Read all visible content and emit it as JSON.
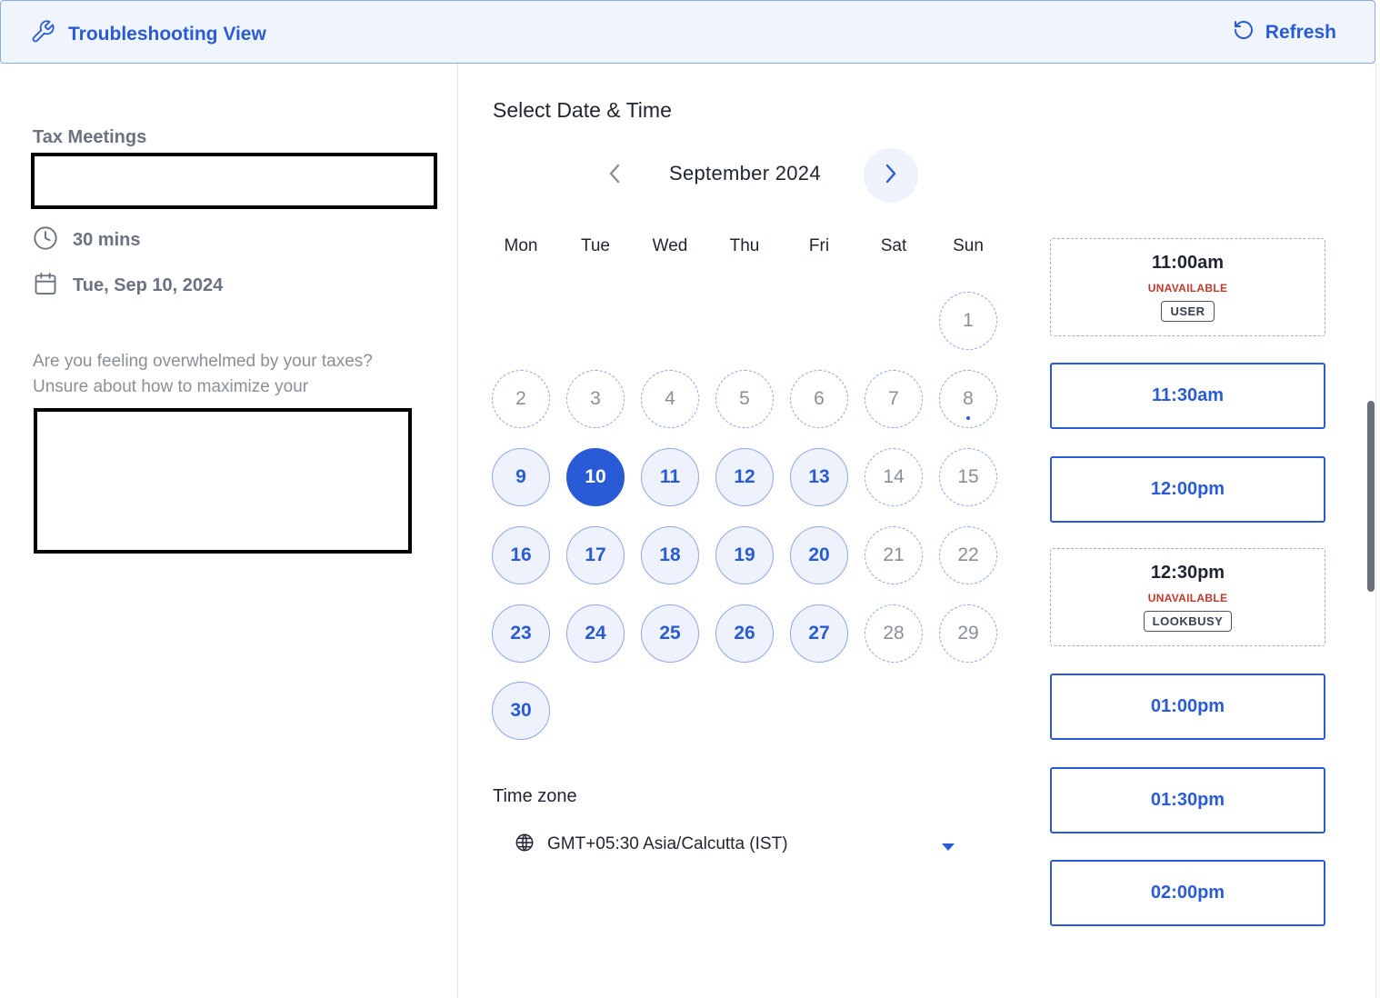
{
  "header": {
    "title": "Troubleshooting View",
    "refresh_label": "Refresh"
  },
  "event": {
    "title": "Tax Meetings",
    "duration": "30 mins",
    "date": "Tue, Sep 10, 2024",
    "description_line1": "Are you feeling overwhelmed by your taxes?",
    "description_line2": "Unsure about how to maximize your"
  },
  "calendar": {
    "section_title": "Select Date & Time",
    "month_label": "September 2024",
    "weekdays": [
      "Mon",
      "Tue",
      "Wed",
      "Thu",
      "Fri",
      "Sat",
      "Sun"
    ],
    "days": [
      {
        "n": "1",
        "col": 6,
        "row": 0,
        "state": "unavailable"
      },
      {
        "n": "2",
        "col": 0,
        "row": 1,
        "state": "unavailable"
      },
      {
        "n": "3",
        "col": 1,
        "row": 1,
        "state": "unavailable"
      },
      {
        "n": "4",
        "col": 2,
        "row": 1,
        "state": "unavailable"
      },
      {
        "n": "5",
        "col": 3,
        "row": 1,
        "state": "unavailable"
      },
      {
        "n": "6",
        "col": 4,
        "row": 1,
        "state": "unavailable"
      },
      {
        "n": "7",
        "col": 5,
        "row": 1,
        "state": "unavailable"
      },
      {
        "n": "8",
        "col": 6,
        "row": 1,
        "state": "unavailable",
        "today": true
      },
      {
        "n": "9",
        "col": 0,
        "row": 2,
        "state": "available"
      },
      {
        "n": "10",
        "col": 1,
        "row": 2,
        "state": "selected"
      },
      {
        "n": "11",
        "col": 2,
        "row": 2,
        "state": "available"
      },
      {
        "n": "12",
        "col": 3,
        "row": 2,
        "state": "available"
      },
      {
        "n": "13",
        "col": 4,
        "row": 2,
        "state": "available"
      },
      {
        "n": "14",
        "col": 5,
        "row": 2,
        "state": "unavailable"
      },
      {
        "n": "15",
        "col": 6,
        "row": 2,
        "state": "unavailable"
      },
      {
        "n": "16",
        "col": 0,
        "row": 3,
        "state": "available"
      },
      {
        "n": "17",
        "col": 1,
        "row": 3,
        "state": "available"
      },
      {
        "n": "18",
        "col": 2,
        "row": 3,
        "state": "available"
      },
      {
        "n": "19",
        "col": 3,
        "row": 3,
        "state": "available"
      },
      {
        "n": "20",
        "col": 4,
        "row": 3,
        "state": "available"
      },
      {
        "n": "21",
        "col": 5,
        "row": 3,
        "state": "unavailable"
      },
      {
        "n": "22",
        "col": 6,
        "row": 3,
        "state": "unavailable"
      },
      {
        "n": "23",
        "col": 0,
        "row": 4,
        "state": "available"
      },
      {
        "n": "24",
        "col": 1,
        "row": 4,
        "state": "available"
      },
      {
        "n": "25",
        "col": 2,
        "row": 4,
        "state": "available"
      },
      {
        "n": "26",
        "col": 3,
        "row": 4,
        "state": "available"
      },
      {
        "n": "27",
        "col": 4,
        "row": 4,
        "state": "available"
      },
      {
        "n": "28",
        "col": 5,
        "row": 4,
        "state": "unavailable"
      },
      {
        "n": "29",
        "col": 6,
        "row": 4,
        "state": "unavailable"
      },
      {
        "n": "30",
        "col": 0,
        "row": 5,
        "state": "available"
      }
    ]
  },
  "timezone": {
    "label": "Time zone",
    "value": "GMT+05:30 Asia/Calcutta (IST)"
  },
  "slots": [
    {
      "time": "11:00am",
      "status": "unavailable",
      "status_label": "UNAVAILABLE",
      "reason": "USER"
    },
    {
      "time": "11:30am",
      "status": "available"
    },
    {
      "time": "12:00pm",
      "status": "available"
    },
    {
      "time": "12:30pm",
      "status": "unavailable",
      "status_label": "UNAVAILABLE",
      "reason": "LOOKBUSY"
    },
    {
      "time": "01:00pm",
      "status": "available"
    },
    {
      "time": "01:30pm",
      "status": "available"
    },
    {
      "time": "02:00pm",
      "status": "available"
    }
  ],
  "colors": {
    "accent": "#2a5bd7",
    "unavailable_text": "#c0392b",
    "header_bg": "#f0f4fd"
  },
  "icons": [
    "wrench-icon",
    "refresh-icon",
    "clock-icon",
    "calendar-icon",
    "globe-icon",
    "chevron-left-icon",
    "chevron-right-icon",
    "caret-down-icon"
  ]
}
